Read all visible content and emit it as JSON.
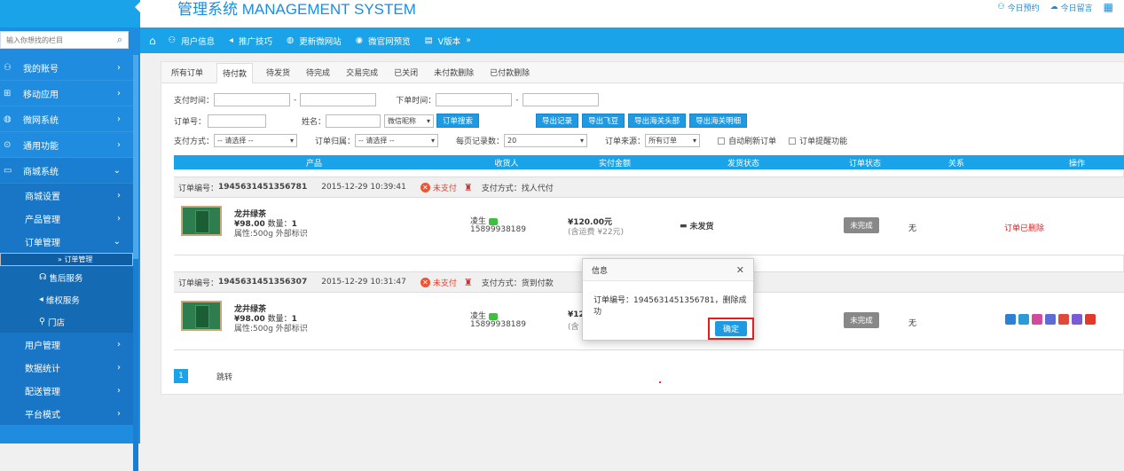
{
  "header": {
    "brand": "管理系统 MANAGEMENT SYSTEM",
    "links": [
      {
        "icon": "person-icon",
        "label": "今日预约"
      },
      {
        "icon": "chat-icon",
        "label": "今日留言"
      }
    ]
  },
  "sidebar": {
    "search_placeholder": "输入你想找的栏目",
    "items": [
      {
        "label": "我的账号"
      },
      {
        "label": "移动应用"
      },
      {
        "label": "微网系统"
      },
      {
        "label": "通用功能"
      },
      {
        "label": "商城系统"
      }
    ],
    "shop_sub": [
      {
        "label": "商城设置"
      },
      {
        "label": "产品管理"
      },
      {
        "label": "订单管理"
      }
    ],
    "order_sub": [
      {
        "label": "» 订单管理"
      },
      {
        "label": "售后服务"
      },
      {
        "label": "维权服务"
      },
      {
        "label": "门店"
      }
    ],
    "more": [
      {
        "label": "用户管理"
      },
      {
        "label": "数据统计"
      },
      {
        "label": "配送管理"
      },
      {
        "label": "平台模式"
      }
    ]
  },
  "nav": {
    "items": [
      {
        "label": "用户信息"
      },
      {
        "label": "推广技巧"
      },
      {
        "label": "更新微网站"
      },
      {
        "label": "微官网预览"
      },
      {
        "label": "V版本"
      }
    ]
  },
  "tabs": [
    "所有订单",
    "待付款",
    "待发货",
    "待完成",
    "交易完成",
    "已关闭",
    "未付款删除",
    "已付款删除"
  ],
  "active_tab": "待付款",
  "filters": {
    "pay_time": "支付时间：",
    "order_time": "下单时间：",
    "dash": "-",
    "order_no": "订单号：",
    "name": "姓名：",
    "wechat_nick": "微信昵称",
    "search_btn": "订单搜索",
    "export_btns": [
      "导出记录",
      "导出飞豆",
      "导出海关头部",
      "导出海关明细"
    ],
    "pay_method": "支付方式：",
    "pay_method_val": "-- 请选择 --",
    "order_owner": "订单归属：",
    "order_owner_val": "-- 请选择 --",
    "per_page": "每页记录数：",
    "per_page_val": "20",
    "order_source": "订单来源：",
    "order_source_val": "所有订单",
    "auto_refresh": "自动刷新订单",
    "order_remind": "订单提醒功能"
  },
  "table": {
    "headers": [
      "产品",
      "收货人",
      "实付金额",
      "发货状态",
      "订单状态",
      "关系",
      "操作"
    ]
  },
  "orders": [
    {
      "order_label": "订单编号：",
      "order_no": "1945631451356781",
      "time": "2015-12-29 10:39:41",
      "status": "未支付",
      "pay_method": "支付方式：找人代付",
      "product": "龙井绿茶",
      "price": "¥98.00",
      "qty_label": "数量：",
      "qty": "1",
      "spec": "属性:500g 外部标识",
      "buyer": "凌生",
      "phone": "15899938189",
      "amount": "¥120.00元",
      "shipping_fee": "(含运费 ¥22元)",
      "ship_status": "未发货",
      "order_status": "未完成",
      "relation": "无",
      "operation": "订单已删除"
    },
    {
      "order_label": "订单编号：",
      "order_no": "1945631451356307",
      "time": "2015-12-29 10:31:47",
      "status": "未支付",
      "pay_method": "支付方式：货到付款",
      "product": "龙井绿茶",
      "price": "¥98.00",
      "qty_label": "数量：",
      "qty": "1",
      "spec": "属性:500g 外部标识",
      "buyer": "凌生",
      "phone": "15899938189",
      "amount": "¥12",
      "shipping_fee": "(含",
      "order_status": "未完成",
      "relation": "无"
    }
  ],
  "pager": {
    "page": "1",
    "jump": "跳转"
  },
  "dialog": {
    "title": "信息",
    "message": "订单编号：1945631451356781，删除成功",
    "ok": "确定"
  },
  "colors": {
    "primary": "#1aa3e8",
    "sidebar": "#1f8ce0",
    "danger": "#e02020"
  }
}
